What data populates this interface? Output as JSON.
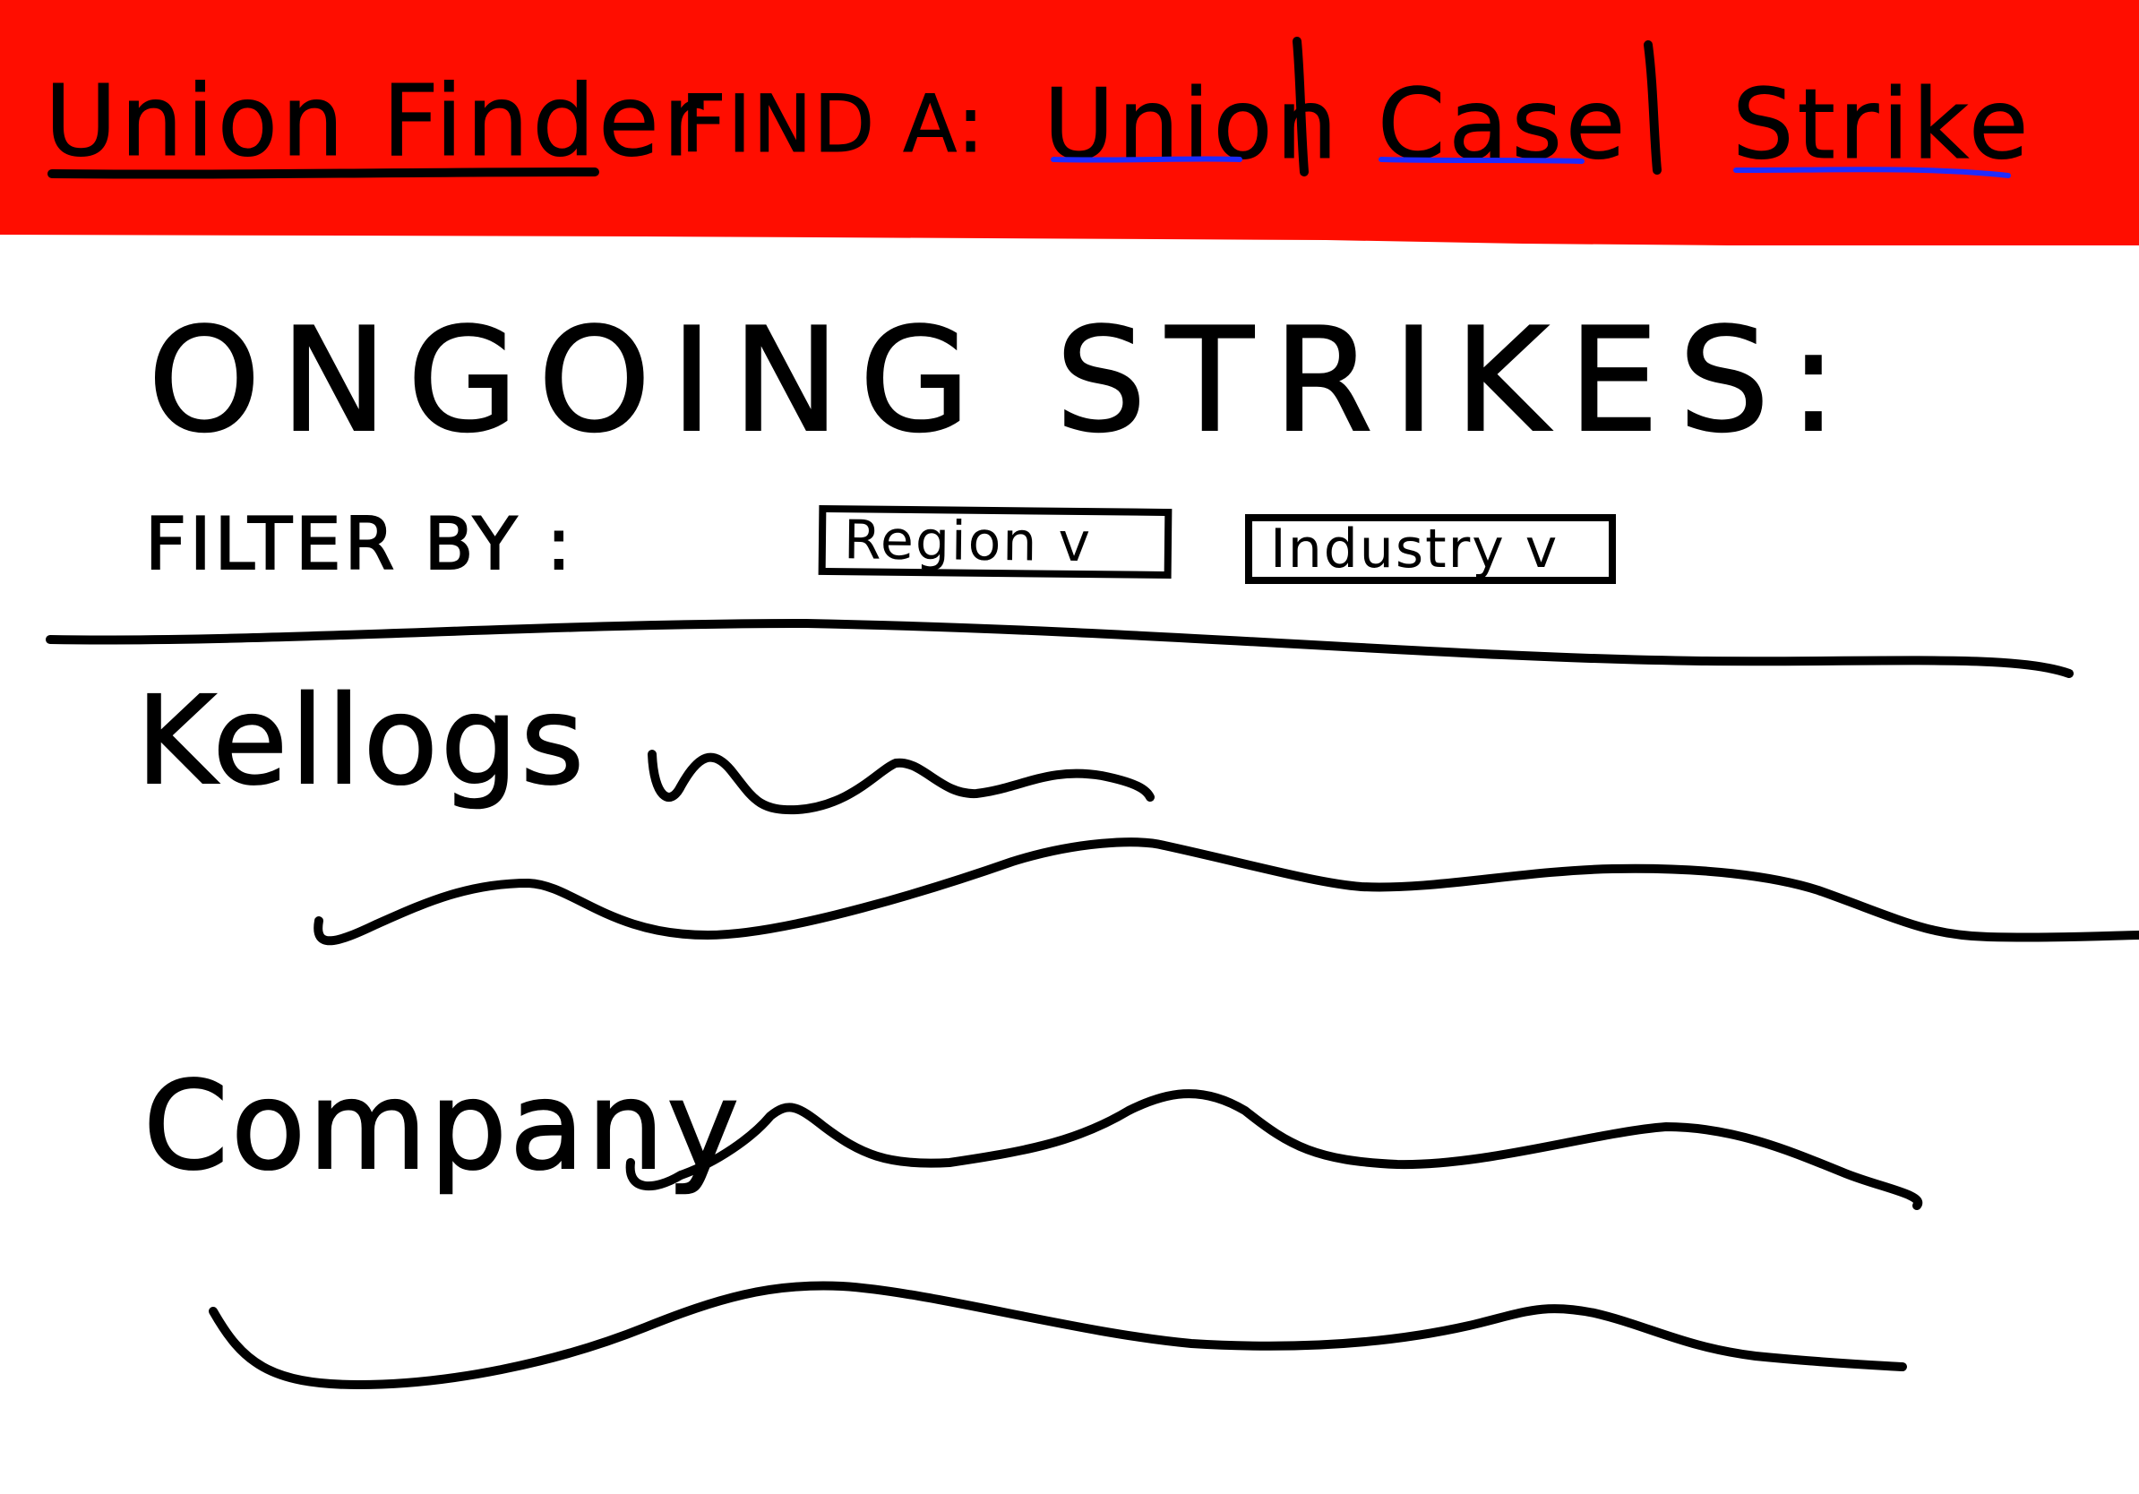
{
  "colors": {
    "header_bg": "#ff0d00",
    "ink": "#000000",
    "link_underline": "#1f2bff",
    "background": "#ffffff"
  },
  "header": {
    "brand": "Union Finder",
    "find_label": "FIND A:",
    "nav": [
      {
        "label": "Union"
      },
      {
        "label": "Case"
      },
      {
        "label": "Strike"
      }
    ],
    "separator": "|"
  },
  "main": {
    "title": "ONGOING STRIKES:",
    "filter": {
      "label": "FILTER BY :",
      "dropdowns": [
        {
          "label": "Region",
          "icon": "chevron-down-icon",
          "caret": "v"
        },
        {
          "label": "Industry",
          "icon": "chevron-down-icon",
          "caret": "v"
        }
      ]
    },
    "strikes": [
      {
        "name": "Kellogs"
      },
      {
        "name": "Company"
      }
    ]
  }
}
